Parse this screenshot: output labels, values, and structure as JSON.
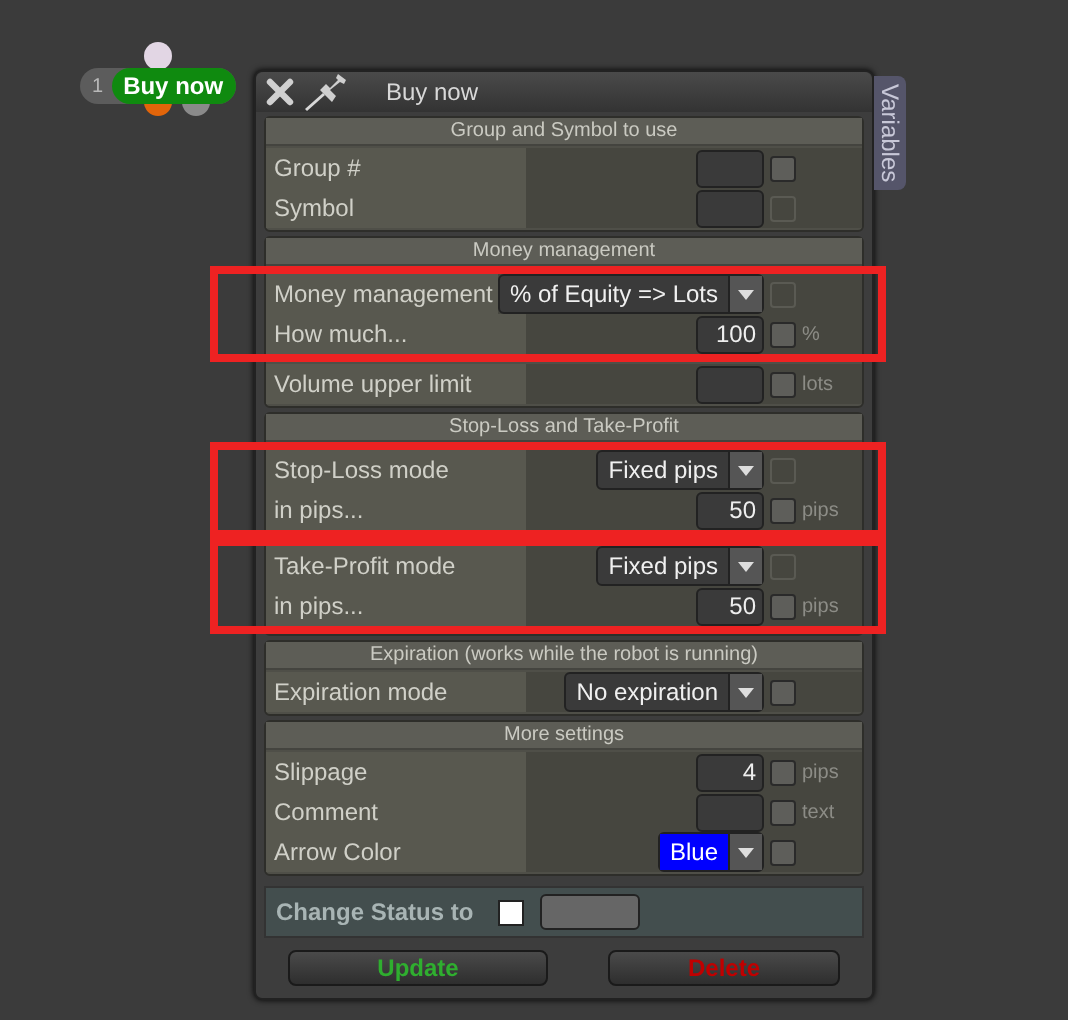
{
  "chip": {
    "number": "1",
    "label": "Buy now"
  },
  "window": {
    "title": "Buy now",
    "side_tab": "Variables"
  },
  "sections": [
    {
      "title": "Group and Symbol to use",
      "groups": [
        {
          "highlighted": false,
          "rows": [
            {
              "kind": "field",
              "label": "Group #",
              "checkbox": {
                "checked": false,
                "disabled": false
              }
            },
            {
              "kind": "field",
              "label": "Symbol",
              "checkbox": {
                "checked": false,
                "disabled": true
              }
            }
          ]
        }
      ]
    },
    {
      "title": "Money management",
      "groups": [
        {
          "highlighted": true,
          "rows": [
            {
              "kind": "dropdown",
              "label": "Money management",
              "value": "% of Equity => Lots",
              "checkbox": {
                "checked": false,
                "disabled": true
              }
            },
            {
              "kind": "field",
              "label": "How much...",
              "value": "100",
              "checkbox": {
                "checked": false,
                "disabled": false
              },
              "unit": "%"
            }
          ]
        },
        {
          "highlighted": false,
          "rows": [
            {
              "kind": "field",
              "label": "Volume upper limit",
              "checkbox": {
                "checked": false,
                "disabled": false
              },
              "unit": "lots"
            }
          ]
        }
      ]
    },
    {
      "title": "Stop-Loss and Take-Profit",
      "groups": [
        {
          "highlighted": true,
          "rows": [
            {
              "kind": "dropdown",
              "label": "Stop-Loss mode",
              "value": "Fixed pips",
              "checkbox": {
                "checked": false,
                "disabled": true
              }
            },
            {
              "kind": "field",
              "label": "in pips...",
              "value": "50",
              "checkbox": {
                "checked": false,
                "disabled": false
              },
              "unit": "pips"
            }
          ]
        },
        {
          "highlighted": true,
          "rows": [
            {
              "kind": "dropdown",
              "label": "Take-Profit mode",
              "value": "Fixed pips",
              "checkbox": {
                "checked": false,
                "disabled": true
              }
            },
            {
              "kind": "field",
              "label": "in pips...",
              "value": "50",
              "checkbox": {
                "checked": false,
                "disabled": false
              },
              "unit": "pips"
            }
          ]
        }
      ]
    },
    {
      "title": "Expiration (works while the robot is running)",
      "groups": [
        {
          "highlighted": false,
          "rows": [
            {
              "kind": "dropdown",
              "label": "Expiration mode",
              "value": "No expiration",
              "checkbox": {
                "checked": false,
                "disabled": false
              }
            }
          ]
        }
      ]
    },
    {
      "title": "More settings",
      "groups": [
        {
          "highlighted": false,
          "rows": [
            {
              "kind": "field",
              "label": "Slippage",
              "value": "4",
              "checkbox": {
                "checked": false,
                "disabled": false
              },
              "unit": "pips"
            },
            {
              "kind": "field",
              "label": "Comment",
              "checkbox": {
                "checked": false,
                "disabled": false
              },
              "unit": "text"
            },
            {
              "kind": "color",
              "label": "Arrow Color",
              "value": "Blue",
              "color": "#0000ff",
              "checkbox": {
                "checked": false,
                "disabled": false
              }
            }
          ]
        }
      ]
    }
  ],
  "status": {
    "label": "Change Status to",
    "checked": false
  },
  "buttons": [
    {
      "kind": "update",
      "label": "Update"
    },
    {
      "kind": "delete",
      "label": "Delete"
    }
  ]
}
